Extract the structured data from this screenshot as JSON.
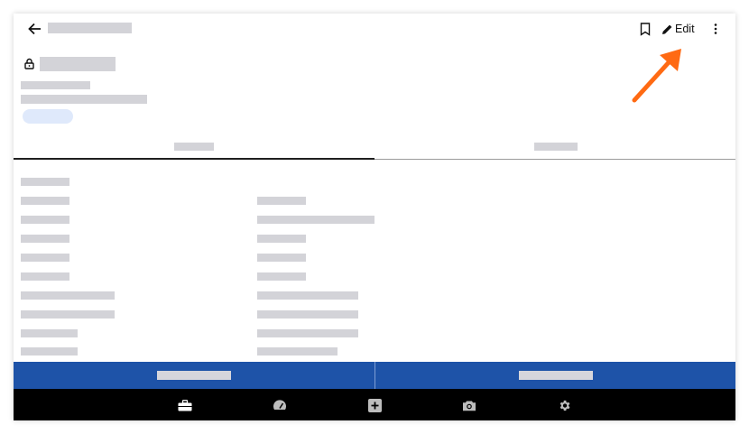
{
  "header": {
    "edit_label": "Edit"
  },
  "icons": {
    "back": "arrow-left-icon",
    "bookmark": "bookmark-icon",
    "edit": "pencil-icon",
    "more": "more-vertical-icon",
    "lock": "lock-icon"
  },
  "bottom_nav": {
    "items": [
      "briefcase-icon",
      "gauge-icon",
      "plus-square-icon",
      "camera-icon",
      "gear-icon"
    ]
  },
  "colors": {
    "action_bar": "#1e53a8",
    "annotation_arrow": "#ff6a13",
    "placeholder": "#d3d3d8",
    "chip": "#dfe9fb"
  }
}
